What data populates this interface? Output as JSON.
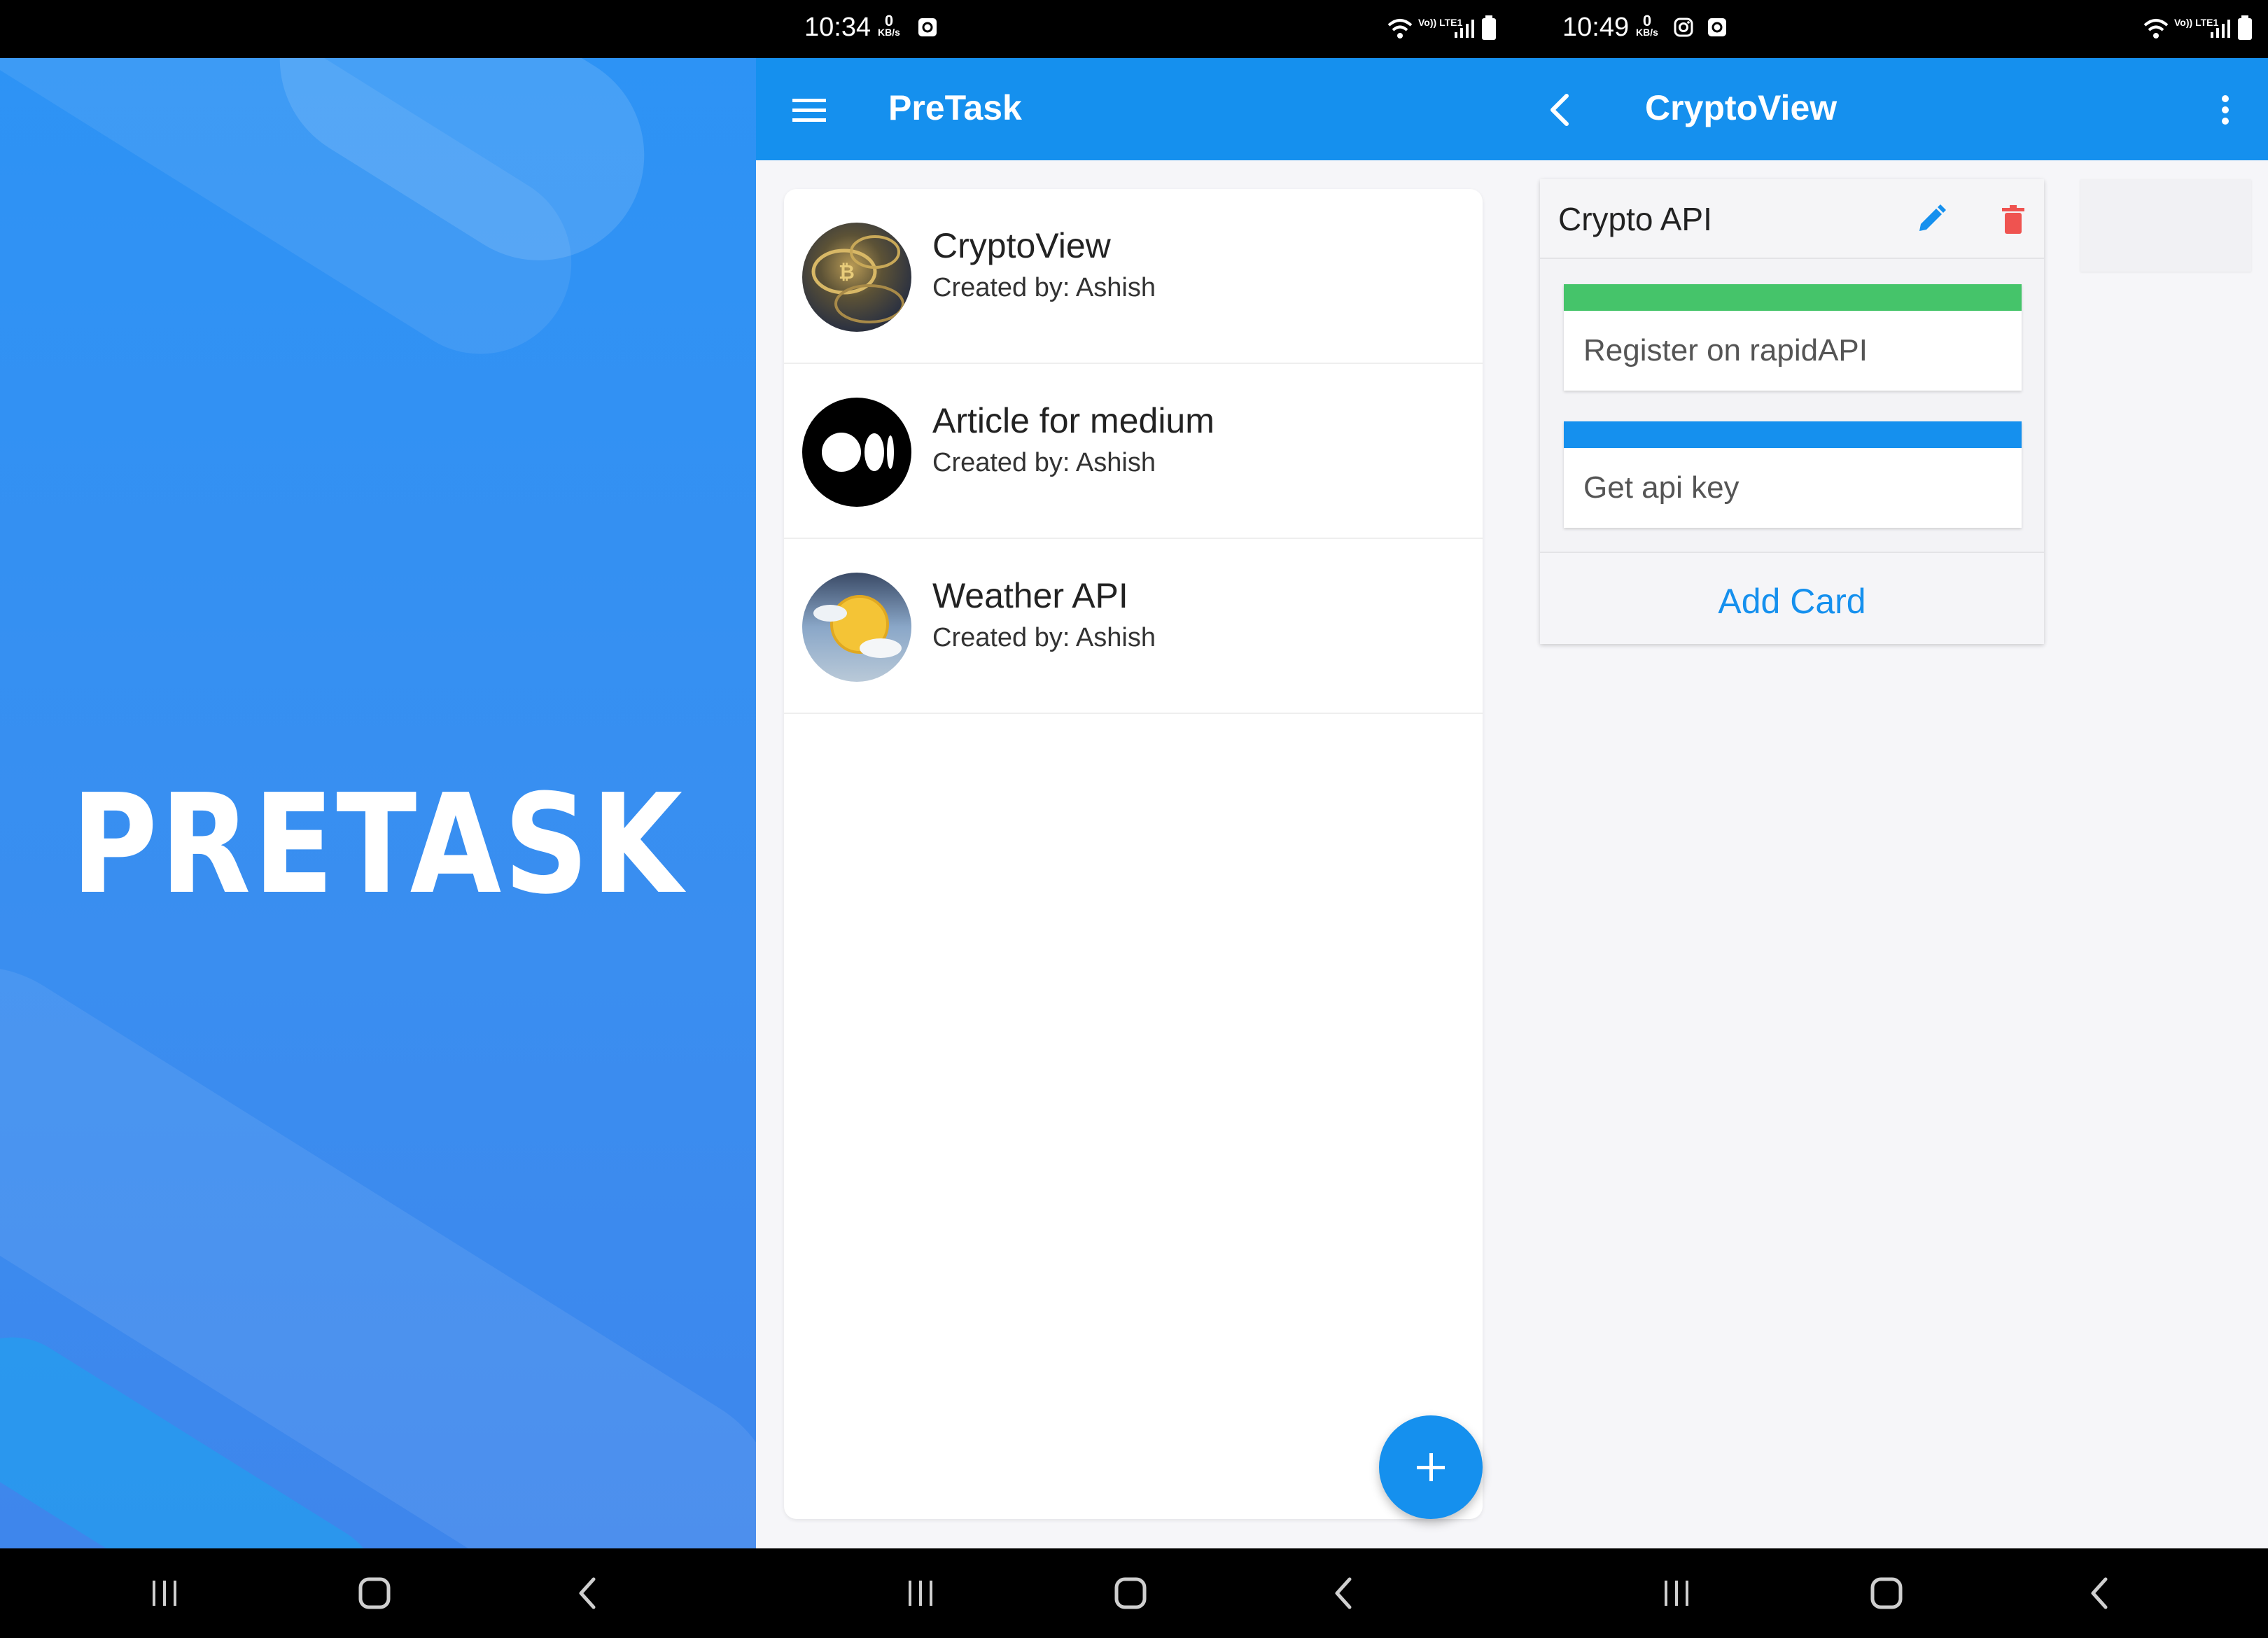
{
  "screens": {
    "splash": {
      "app_name": "PRETASK",
      "background_color": "#2f91f3"
    },
    "board_list": {
      "status": {
        "time": "10:34",
        "kbs_value": "0",
        "kbs_unit": "KB/s",
        "network": "Vo)) LTE1"
      },
      "appbar": {
        "title": "PreTask",
        "menu_icon": "hamburger-menu-icon"
      },
      "boards": [
        {
          "name": "CryptoView",
          "created_by": "Created by: Ashish",
          "avatar": "crypto-coins-image"
        },
        {
          "name": "Article for medium",
          "created_by": "Created by: Ashish",
          "avatar": "medium-logo"
        },
        {
          "name": "Weather API",
          "created_by": "Created by: Ashish",
          "avatar": "weather-sun-cloud-image"
        }
      ],
      "fab_icon": "plus-icon"
    },
    "board_view": {
      "status": {
        "time": "10:49",
        "kbs_value": "0",
        "kbs_unit": "KB/s",
        "network": "Vo)) LTE1"
      },
      "appbar": {
        "title": "CryptoView",
        "back_icon": "back-arrow-icon",
        "more_icon": "more-vert-icon"
      },
      "list": {
        "title": "Crypto API",
        "edit_icon": "pencil-icon",
        "delete_icon": "trash-icon",
        "cards": [
          {
            "text": "Register on rapidAPI",
            "label_color": "#45c46a"
          },
          {
            "text": "Get api key",
            "label_color": "#1590ee"
          }
        ],
        "add_card_label": "Add Card"
      }
    }
  },
  "colors": {
    "primary": "#1590ee",
    "delete": "#ef5350",
    "label_green": "#45c46a"
  }
}
